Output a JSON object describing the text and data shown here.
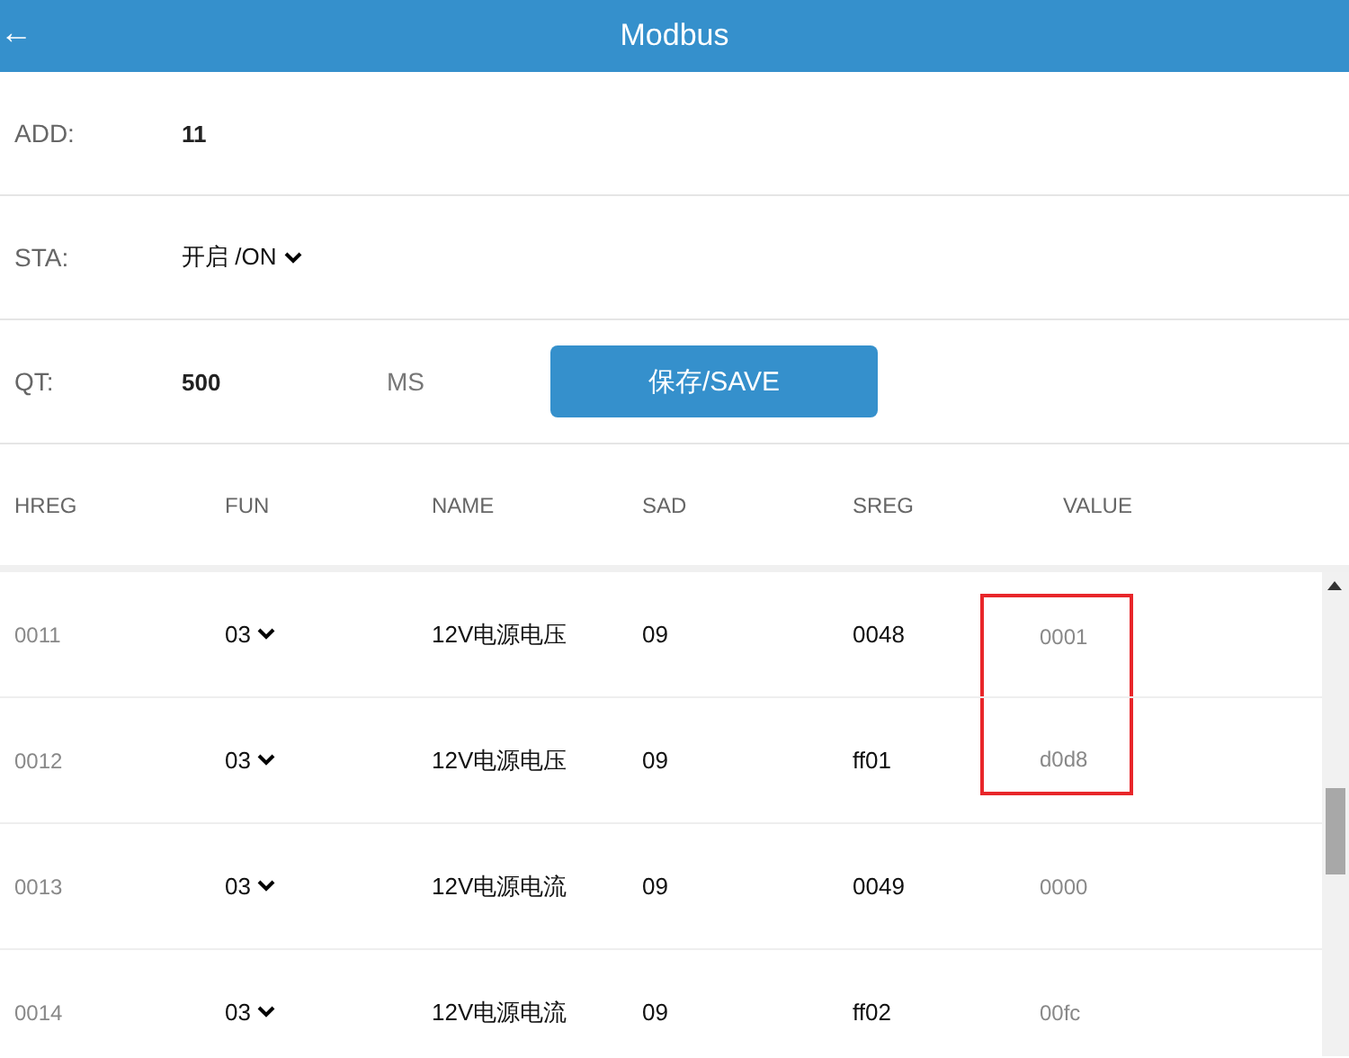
{
  "header": {
    "back": "←",
    "title": "Modbus"
  },
  "settings": [
    {
      "kind": "text",
      "label": "ADD:",
      "value": "11"
    },
    {
      "kind": "select",
      "label": "STA:",
      "value": "开启 /ON"
    },
    {
      "kind": "interval",
      "label": "QT:",
      "value": "500",
      "unit": "MS",
      "button": "保存/SAVE"
    }
  ],
  "table": {
    "columns": [
      "HREG",
      "FUN",
      "NAME",
      "SAD",
      "SREG",
      "VALUE"
    ],
    "rows": [
      {
        "hreg": "0011",
        "fun": "03",
        "name": "12V电源电压",
        "sad": "09",
        "sreg": "0048",
        "value": "0001",
        "highlighted": true
      },
      {
        "hreg": "0012",
        "fun": "03",
        "name": "12V电源电压",
        "sad": "09",
        "sreg": "ff01",
        "value": "d0d8",
        "highlighted": true
      },
      {
        "hreg": "0013",
        "fun": "03",
        "name": "12V电源电流",
        "sad": "09",
        "sreg": "0049",
        "value": "0000",
        "highlighted": false
      },
      {
        "hreg": "0014",
        "fun": "03",
        "name": "12V电源电流",
        "sad": "09",
        "sreg": "ff02",
        "value": "00fc",
        "highlighted": false
      }
    ]
  }
}
